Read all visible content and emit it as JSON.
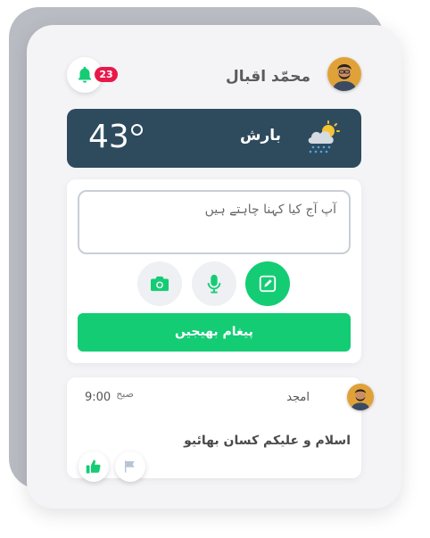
{
  "header": {
    "user_name": "محمّد اقبال",
    "notification_count": "23"
  },
  "weather": {
    "temperature": "43",
    "condition": "بارش",
    "icon": "cloud-rain-sun-icon"
  },
  "compose": {
    "placeholder": "آپ آج کیا کہنا چاہتے ہیں",
    "value": "",
    "icons": [
      "camera-icon",
      "mic-icon",
      "edit-icon"
    ],
    "send_label": "پیغام بھیجیں"
  },
  "post": {
    "author": "امجد",
    "time": "9:00",
    "time_period": "صبح",
    "text": "اسلام و علیکم کسان بھائیو",
    "reactions": [
      "thumbs-up-icon",
      "flag-icon"
    ]
  },
  "colors": {
    "accent": "#14cc74",
    "weather_bg": "#2e4b5e",
    "badge": "#e8194a"
  }
}
